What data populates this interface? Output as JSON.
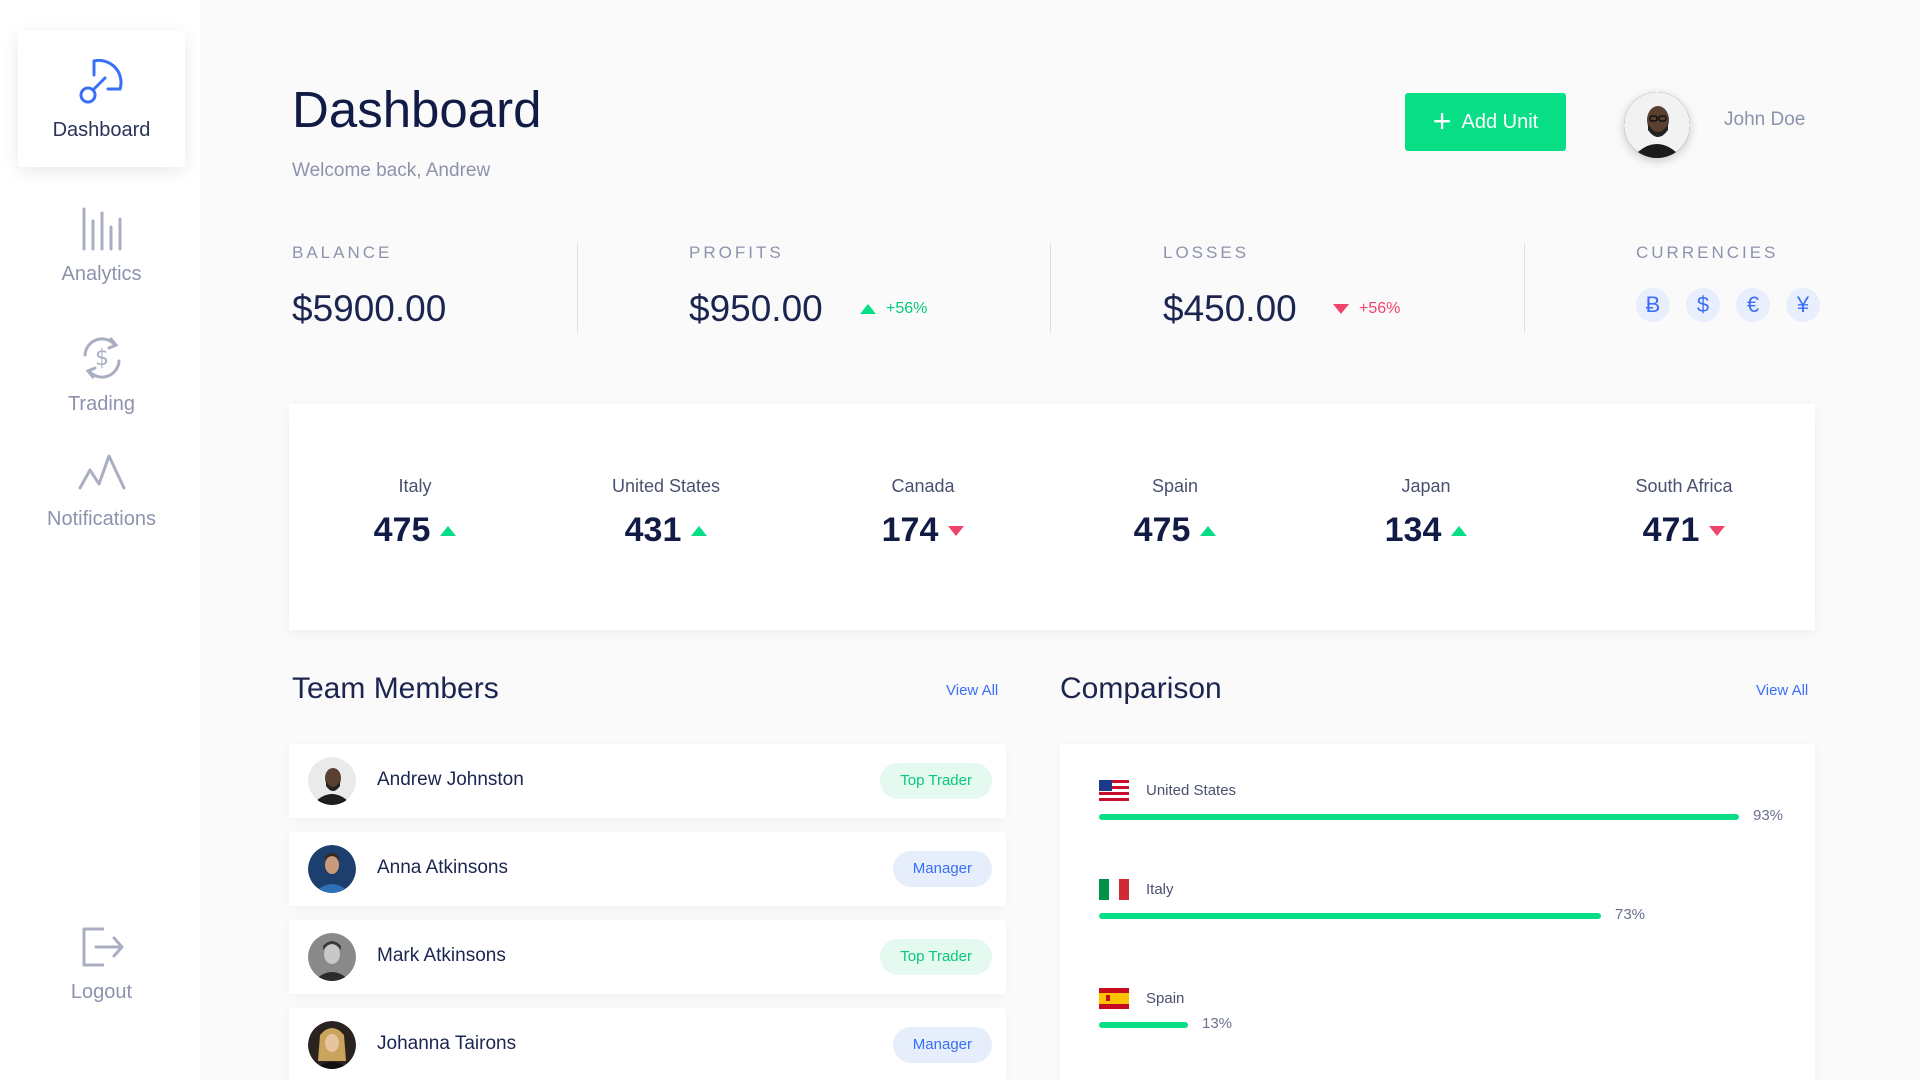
{
  "sidebar": {
    "items": [
      {
        "label": "Dashboard",
        "icon": "gauge-icon",
        "active": true
      },
      {
        "label": "Analytics",
        "icon": "bar-chart-icon"
      },
      {
        "label": "Trading",
        "icon": "dollar-exchange-icon"
      },
      {
        "label": "Notifications",
        "icon": "pulse-icon"
      }
    ],
    "logout": {
      "label": "Logout",
      "icon": "logout-icon"
    }
  },
  "header": {
    "title": "Dashboard",
    "subtitle": "Welcome back, Andrew",
    "add_button": "Add Unit",
    "user_name": "John Doe"
  },
  "stats": {
    "balance": {
      "label": "BALANCE",
      "value": "$5900.00"
    },
    "profits": {
      "label": "PROFITS",
      "value": "$950.00",
      "change": "+56%"
    },
    "losses": {
      "label": "LOSSES",
      "value": "$450.00",
      "change": "+56%"
    },
    "currencies": {
      "label": "CURRENCIES",
      "symbols": [
        "Ƀ",
        "$",
        "€",
        "¥"
      ]
    }
  },
  "countries": [
    {
      "name": "Italy",
      "value": "475",
      "trend": "up"
    },
    {
      "name": "United States",
      "value": "431",
      "trend": "up"
    },
    {
      "name": "Canada",
      "value": "174",
      "trend": "down"
    },
    {
      "name": "Spain",
      "value": "475",
      "trend": "up"
    },
    {
      "name": "Japan",
      "value": "134",
      "trend": "up"
    },
    {
      "name": "South Africa",
      "value": "471",
      "trend": "down"
    }
  ],
  "team": {
    "title": "Team Members",
    "view_all": "View All",
    "members": [
      {
        "name": "Andrew Johnston",
        "role": "Top Trader"
      },
      {
        "name": "Anna Atkinsons",
        "role": "Manager"
      },
      {
        "name": "Mark Atkinsons",
        "role": "Top Trader"
      },
      {
        "name": "Johanna Tairons",
        "role": "Manager"
      }
    ]
  },
  "comparison": {
    "title": "Comparison",
    "view_all": "View All",
    "rows": [
      {
        "country": "United States",
        "percent": "93%",
        "value": 93
      },
      {
        "country": "Italy",
        "percent": "73%",
        "value": 73
      },
      {
        "country": "Spain",
        "percent": "13%",
        "value": 13
      }
    ]
  },
  "colors": {
    "accent_green": "#08de85",
    "accent_blue": "#3a6ff7",
    "down_red": "#f0436b",
    "title_navy": "#121b46"
  }
}
